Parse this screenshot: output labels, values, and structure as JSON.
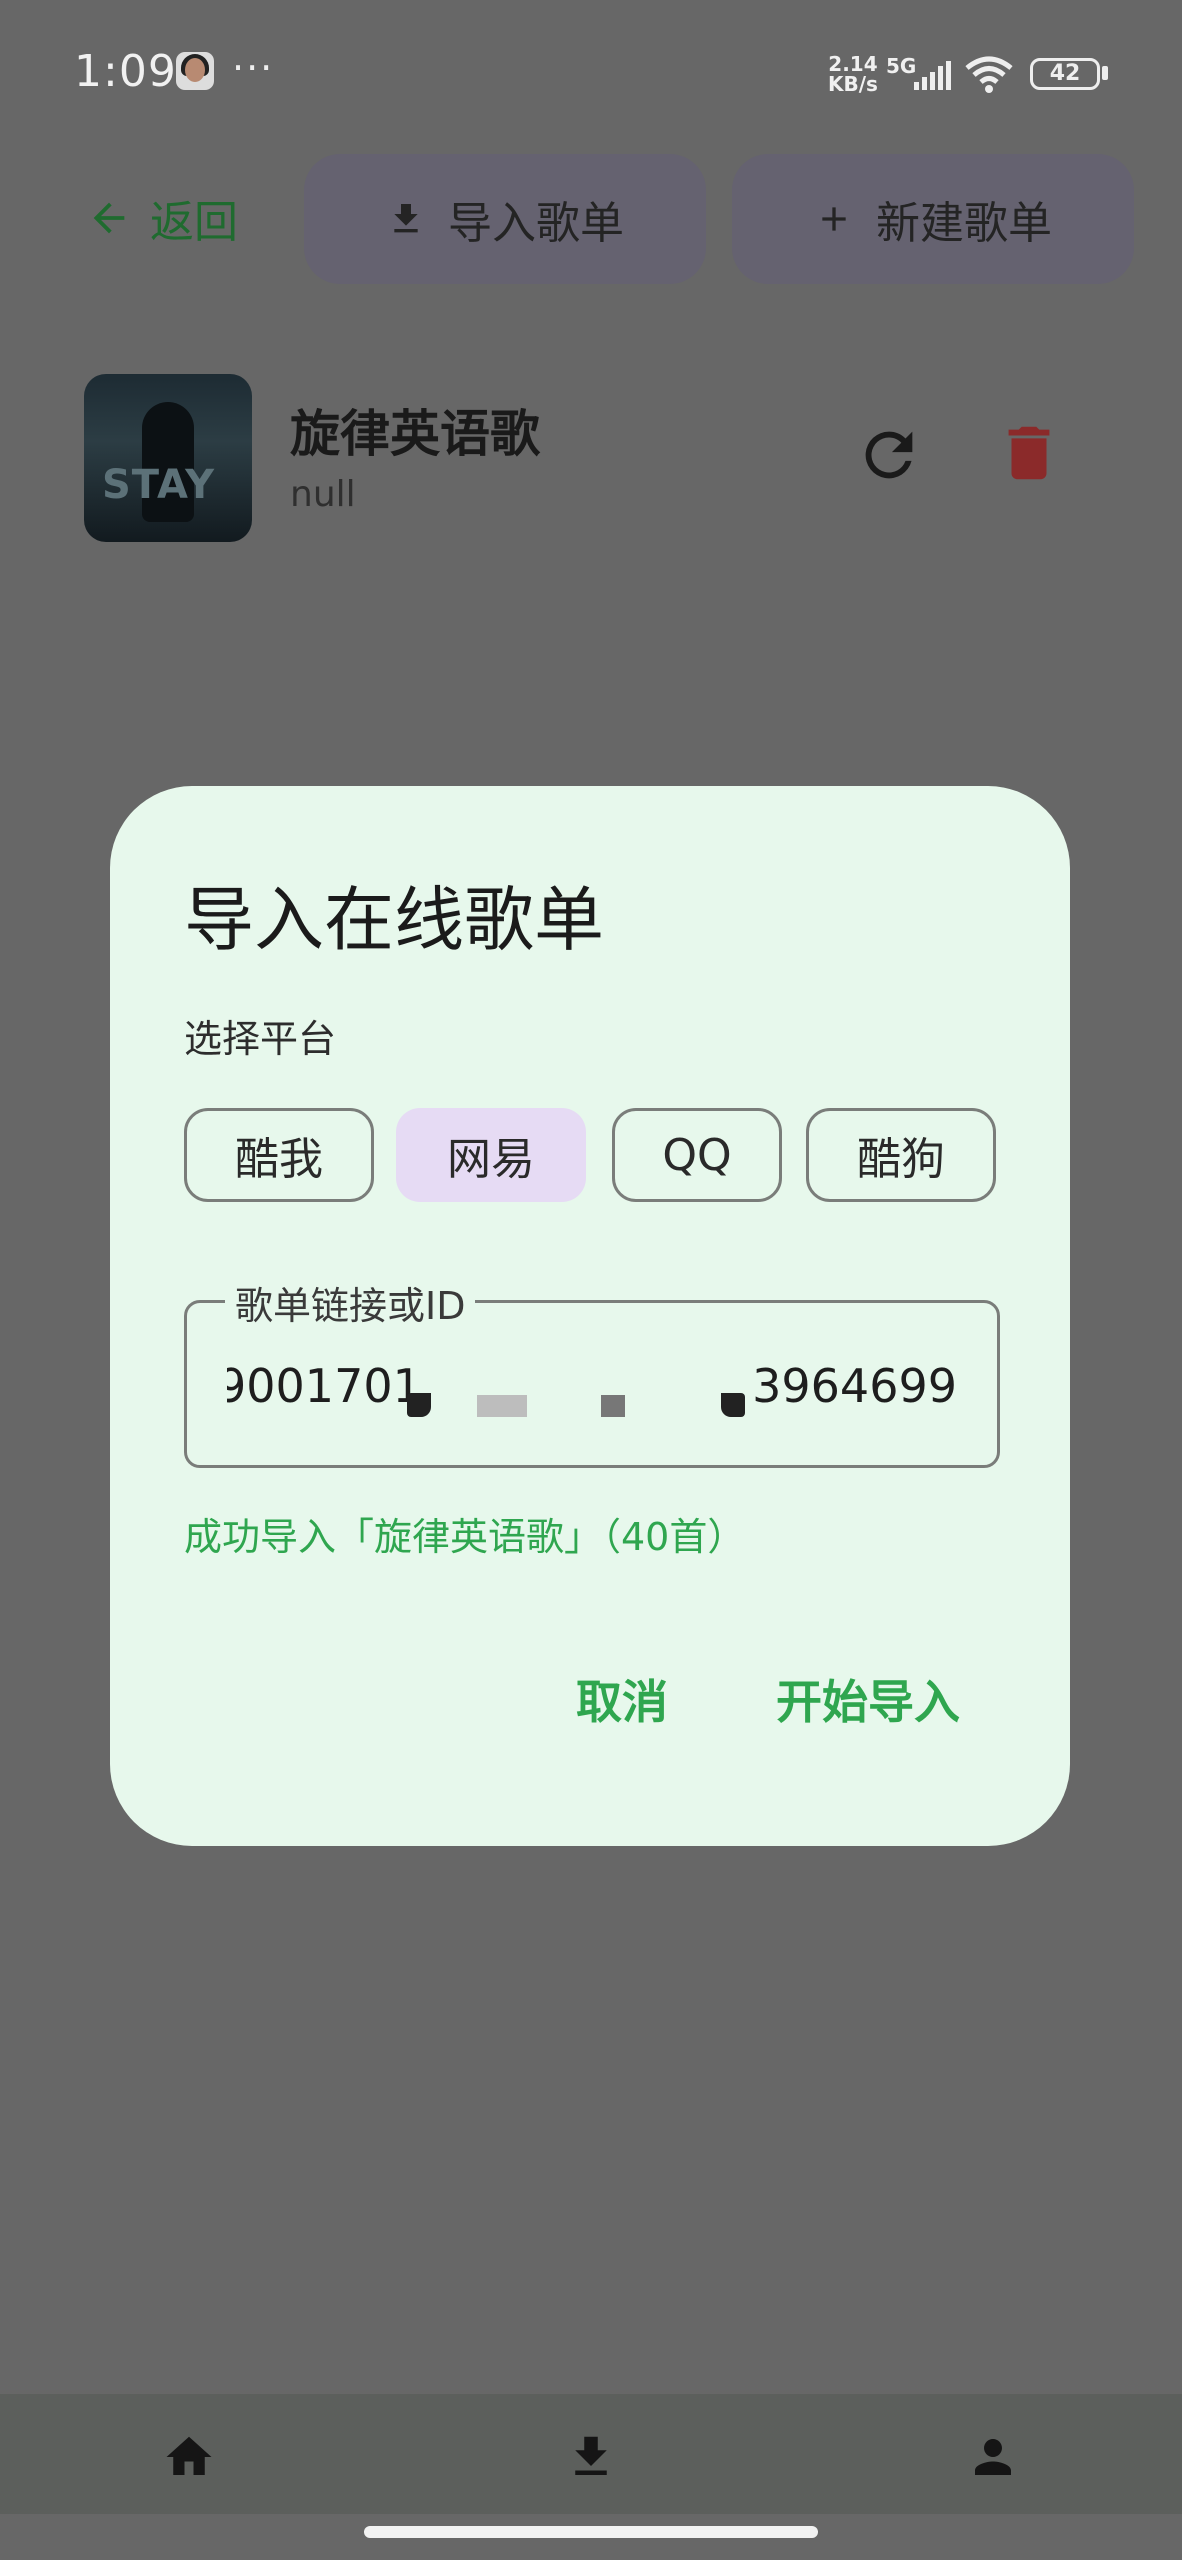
{
  "status_bar": {
    "time": "1:09",
    "more": "···",
    "net_speed_value": "2.14",
    "net_speed_unit": "KB/s",
    "network": "5G",
    "battery": "42"
  },
  "toolbar": {
    "back_label": "返回",
    "import_label": "导入歌单",
    "new_label": "新建歌单"
  },
  "playlist": {
    "cover_text": "STAY",
    "title": "旋律英语歌",
    "subtitle": "null"
  },
  "dialog": {
    "title": "导入在线歌单",
    "platform_label": "选择平台",
    "platforms": [
      "酷我",
      "网易",
      "QQ",
      "酷狗"
    ],
    "selected_platform": "网易",
    "field_label": "歌单链接或ID",
    "field_value_start": "9001701",
    "field_value_end": "3964699",
    "success_message": "成功导入「旋律英语歌」（40首）",
    "cancel_label": "取消",
    "confirm_label": "开始导入"
  },
  "bottom_nav": {
    "items": [
      "home-icon",
      "download-icon",
      "person-icon"
    ]
  },
  "colors": {
    "accent_green": "#2fa64f",
    "back_green": "#1f6b2f",
    "dialog_bg": "#e7f8ec",
    "chip_selected_bg": "#e6dbf4",
    "delete_red": "#8b2a2a",
    "scrim": "#676767"
  }
}
